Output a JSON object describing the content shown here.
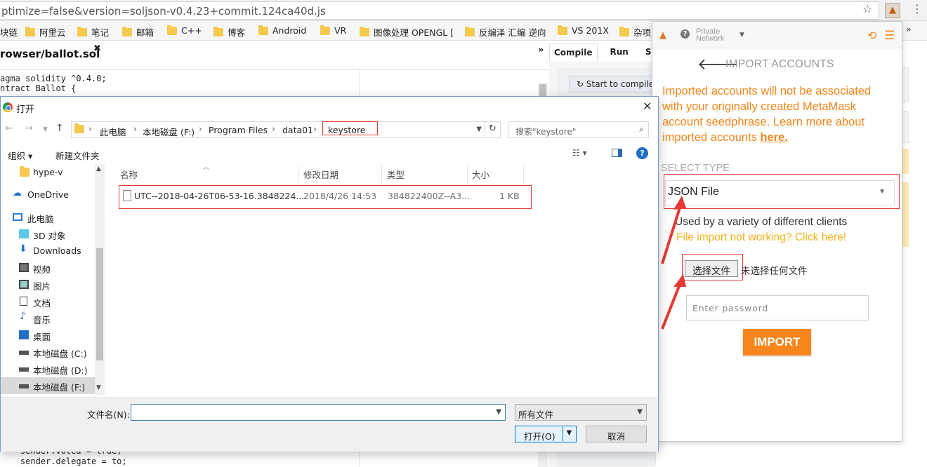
{
  "browser": {
    "url": "ptimize=false&version=soljson-v0.4.23+commit.124ca40d.js",
    "bookmarks": [
      "块链",
      "阿里云",
      "笔记",
      "邮箱",
      "C++",
      "博客",
      "Android",
      "VR",
      "图像处理 OPENGL [",
      "反编泽 汇编 逆向",
      "VS 201X",
      "杂项"
    ],
    "bookmarks_more": "»"
  },
  "editor": {
    "tab_label": "rowser/ballot.sol",
    "code_top": [
      "agma solidity ^0.4.0;",
      "ntract Ballot {"
    ],
    "code_bottom": [
      "    sender.voted = true;",
      "    sender.delegate = to;"
    ]
  },
  "remix": {
    "tabs": [
      "Compile",
      "Run",
      "Set"
    ],
    "compile_button": "Start to compile"
  },
  "metamask": {
    "network_line1": "Private",
    "network_line2": "Network",
    "title": "IMPORT ACCOUNTS",
    "warning_text": "Imported accounts will not be associated with your originally created MetaMask account seedphrase. Learn more about imported accounts ",
    "warning_link": "here.",
    "select_type_label": "SELECT TYPE",
    "select_value": "JSON File",
    "clients_text": "Used by a variety of different clients",
    "not_working_text": "File import not working? Click here!",
    "choose_file_button": "选择文件",
    "no_file_text": "未选择任何文件",
    "password_placeholder": "Enter password",
    "import_button": "IMPORT",
    "colors": {
      "accent": "#f6851b",
      "highlight": "#e53935"
    }
  },
  "dialog": {
    "title": "打开",
    "breadcrumbs": [
      "此电脑",
      "本地磁盘 (F:)",
      "Program Files",
      "data01",
      "keystore"
    ],
    "search_placeholder": "搜索\"keystore\"",
    "toolbar": {
      "organize": "组织 ▾",
      "new_folder": "新建文件夹"
    },
    "sidebar": [
      {
        "label": "hype-v",
        "icon": "folder-icon"
      },
      {
        "label": "OneDrive",
        "icon": "cloud-icon"
      },
      {
        "label": "此电脑",
        "icon": "computer-icon"
      },
      {
        "label": "3D 对象",
        "icon": "cube-icon"
      },
      {
        "label": "Downloads",
        "icon": "download-icon"
      },
      {
        "label": "视频",
        "icon": "video-icon"
      },
      {
        "label": "图片",
        "icon": "picture-icon"
      },
      {
        "label": "文档",
        "icon": "document-icon"
      },
      {
        "label": "音乐",
        "icon": "music-icon"
      },
      {
        "label": "桌面",
        "icon": "desktop-icon"
      },
      {
        "label": "本地磁盘 (C:)",
        "icon": "drive-icon"
      },
      {
        "label": "本地磁盘 (D:)",
        "icon": "drive-icon"
      },
      {
        "label": "本地磁盘 (F:)",
        "icon": "drive-icon"
      }
    ],
    "columns": [
      "名称",
      "修改日期",
      "类型",
      "大小"
    ],
    "files": [
      {
        "name": "UTC--2018-04-26T06-53-16.3848224...",
        "date": "2018/4/26 14:53",
        "type": "384822400Z--A3...",
        "size": "1 KB"
      }
    ],
    "filename_label": "文件名(N):",
    "filename_value": "",
    "filetype_value": "所有文件",
    "open_button": "打开(O)",
    "cancel_button": "取消"
  }
}
